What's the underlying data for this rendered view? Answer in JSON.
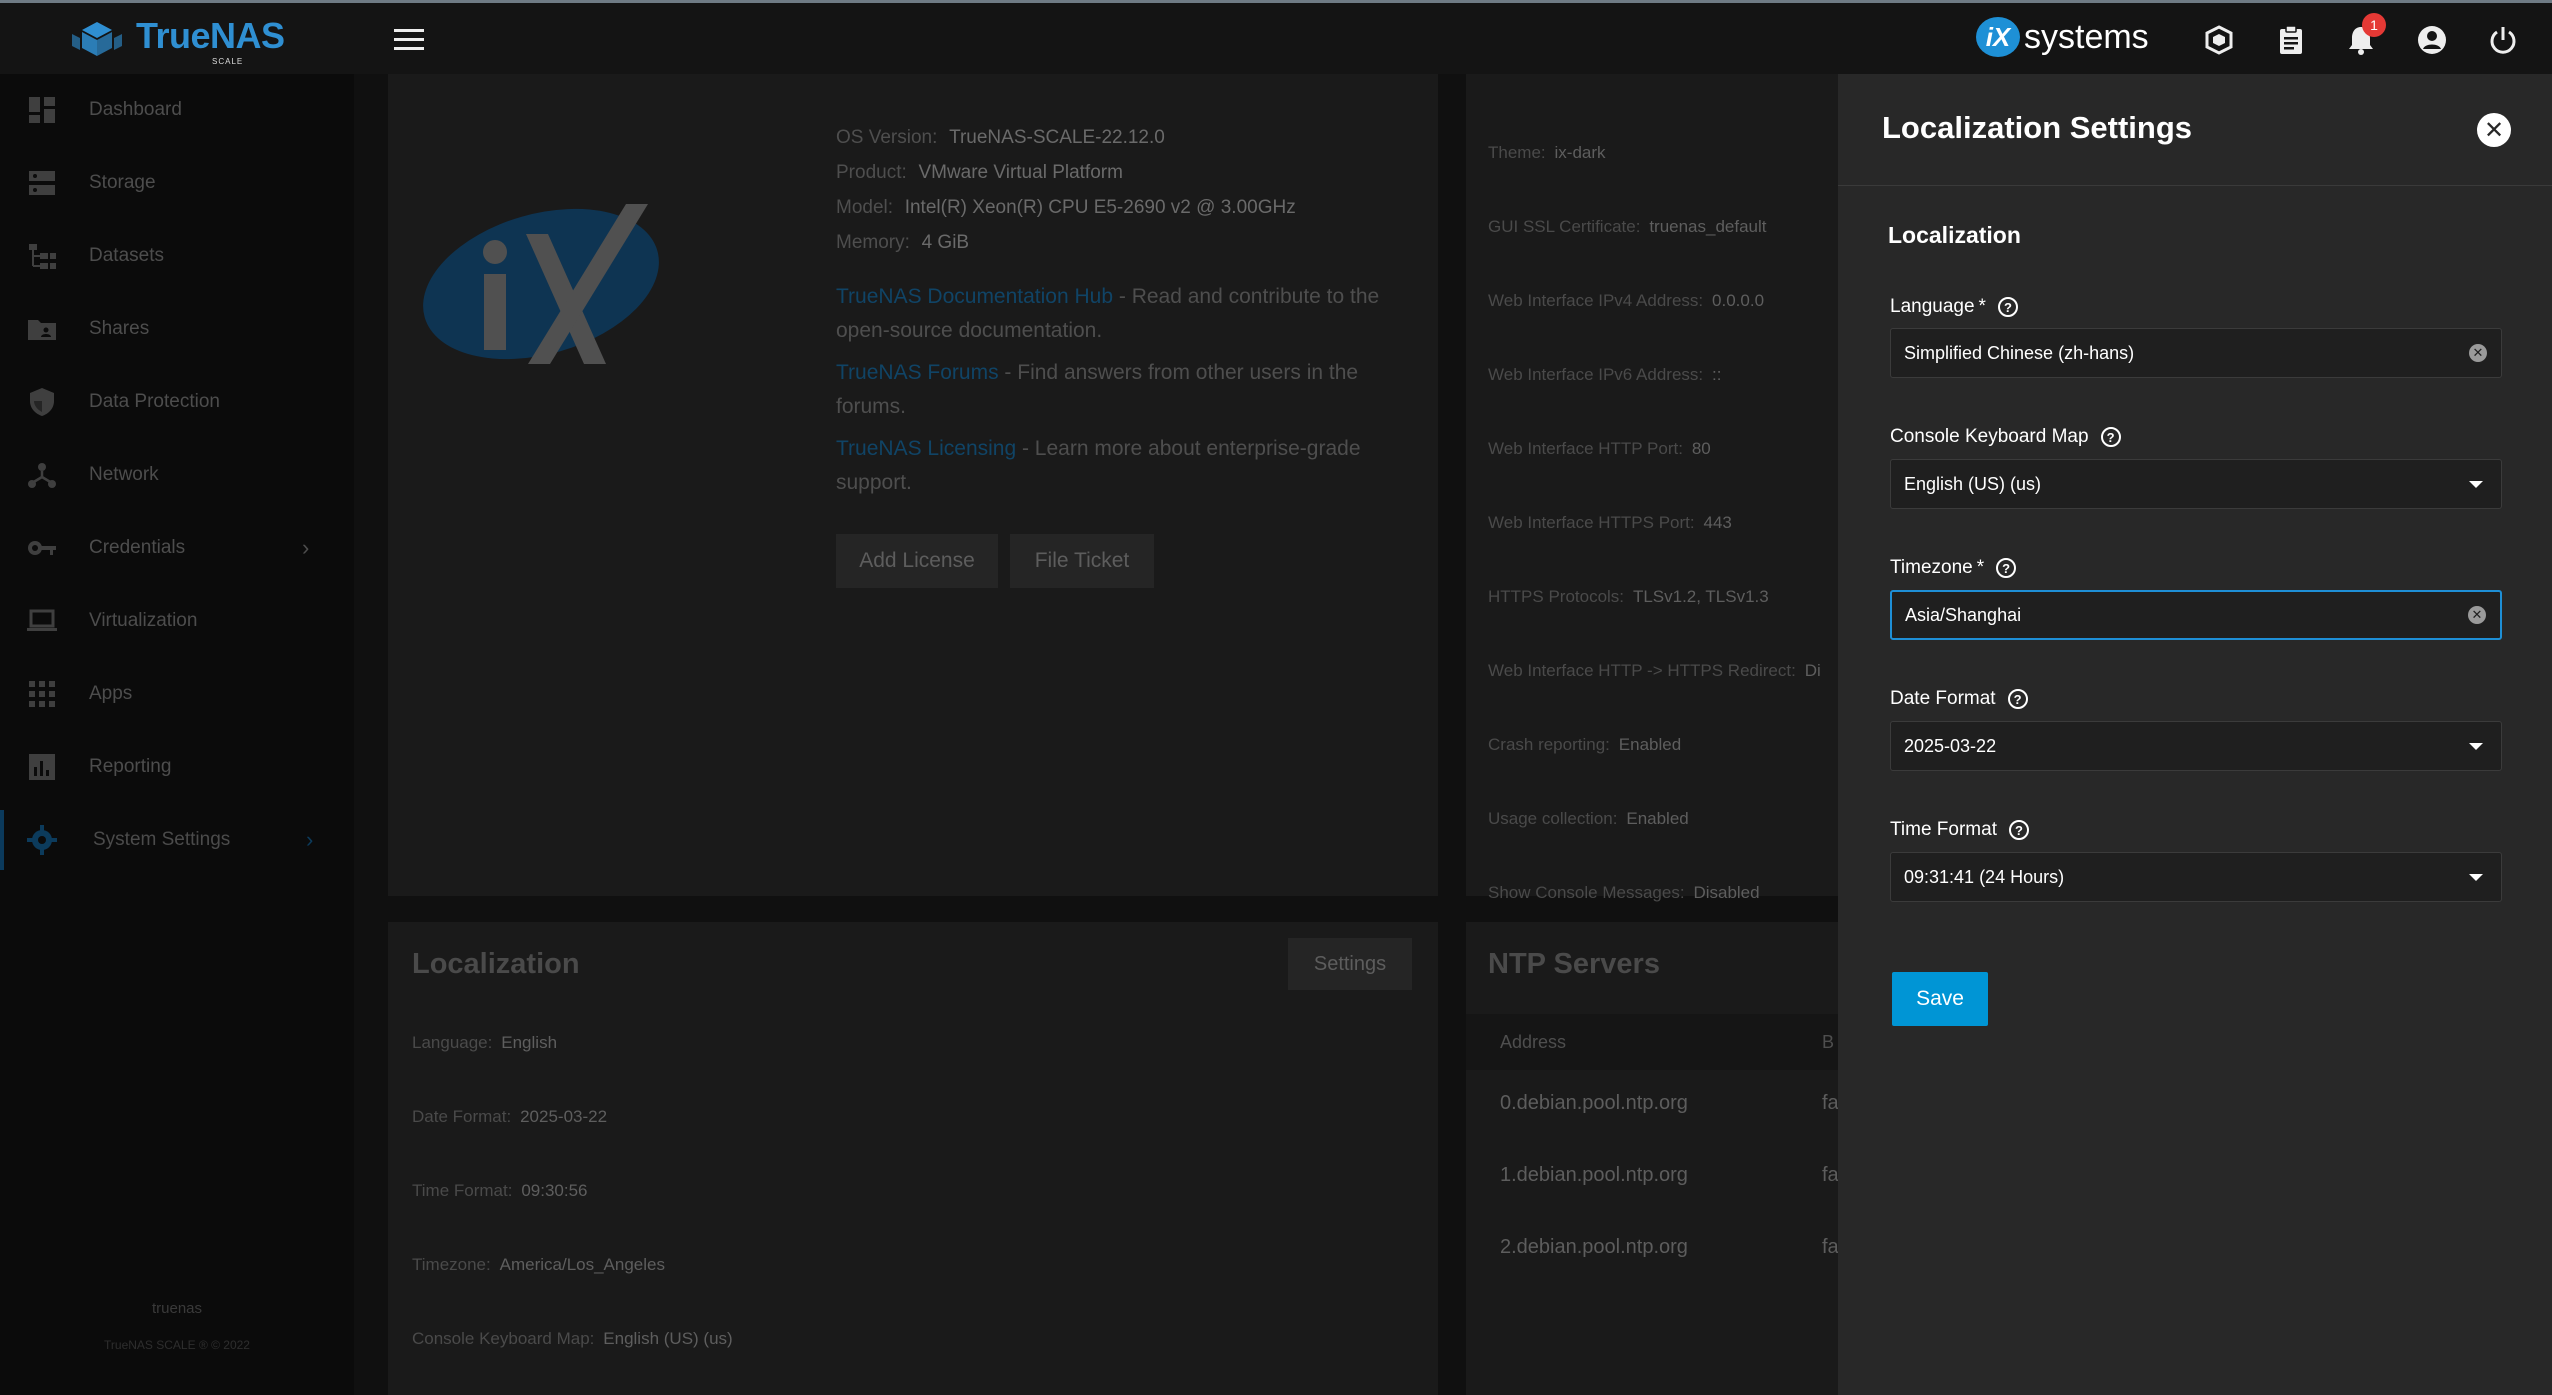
{
  "brand": {
    "logo_text": "TrueNAS",
    "logo_sub": "SCALE",
    "partner_ix": "iX",
    "partner_text": "systems"
  },
  "notifications": {
    "count": "1"
  },
  "sidebar": {
    "items": [
      {
        "label": "Dashboard",
        "icon": "dashboard-icon"
      },
      {
        "label": "Storage",
        "icon": "storage-icon"
      },
      {
        "label": "Datasets",
        "icon": "datasets-icon"
      },
      {
        "label": "Shares",
        "icon": "shares-folder-icon"
      },
      {
        "label": "Data Protection",
        "icon": "shield-icon"
      },
      {
        "label": "Network",
        "icon": "network-icon"
      },
      {
        "label": "Credentials",
        "icon": "key-icon"
      },
      {
        "label": "Virtualization",
        "icon": "laptop-icon"
      },
      {
        "label": "Apps",
        "icon": "apps-grid-icon"
      },
      {
        "label": "Reporting",
        "icon": "reporting-chart-icon"
      },
      {
        "label": "System Settings",
        "icon": "gear-icon"
      }
    ],
    "hostname": "truenas",
    "copyright": "TrueNAS SCALE ® © 2022"
  },
  "system_info": {
    "os_label": "OS Version:",
    "os_value": "TrueNAS-SCALE-22.12.0",
    "product_label": "Product:",
    "product_value": "VMware Virtual Platform",
    "model_label": "Model:",
    "model_value": "Intel(R) Xeon(R) CPU E5-2690 v2 @ 3.00GHz",
    "memory_label": "Memory:",
    "memory_value": "4 GiB",
    "doc_link": "TrueNAS Documentation Hub",
    "doc_text1": " - Read and contribute to the",
    "doc_text2": "open-source documentation.",
    "forums_link": "TrueNAS Forums",
    "forums_text1": " - Find answers from other users in the",
    "forums_text2": "forums.",
    "licensing_link": "TrueNAS Licensing",
    "licensing_text1": " - Learn more about enterprise-grade",
    "licensing_text2": "support.",
    "add_license": "Add License",
    "file_ticket": "File Ticket"
  },
  "gui": {
    "rows": [
      {
        "label": "Theme:",
        "value": "ix-dark"
      },
      {
        "label": "GUI SSL Certificate:",
        "value": "truenas_default"
      },
      {
        "label": "Web Interface IPv4 Address:",
        "value": "0.0.0.0"
      },
      {
        "label": "Web Interface IPv6 Address:",
        "value": "::"
      },
      {
        "label": "Web Interface HTTP Port:",
        "value": "80"
      },
      {
        "label": "Web Interface HTTPS Port:",
        "value": "443"
      },
      {
        "label": "HTTPS Protocols:",
        "value": "TLSv1.2, TLSv1.3"
      },
      {
        "label": "Web Interface HTTP -> HTTPS Redirect:",
        "value": "Di"
      },
      {
        "label": "Crash reporting:",
        "value": "Enabled"
      },
      {
        "label": "Usage collection:",
        "value": "Enabled"
      },
      {
        "label": "Show Console Messages:",
        "value": "Disabled"
      }
    ]
  },
  "localization_card": {
    "title": "Localization",
    "settings_button": "Settings",
    "rows": [
      {
        "label": "Language:",
        "value": "English"
      },
      {
        "label": "Date Format:",
        "value": "2025-03-22"
      },
      {
        "label": "Time Format:",
        "value": "09:30:56"
      },
      {
        "label": "Timezone:",
        "value": "America/Los_Angeles"
      },
      {
        "label": "Console Keyboard Map:",
        "value": "English (US) (us)"
      }
    ]
  },
  "ntp_card": {
    "title": "NTP Servers",
    "col_address": "Address",
    "col_second": "B",
    "rows": [
      {
        "address": "0.debian.pool.ntp.org",
        "second": "fa"
      },
      {
        "address": "1.debian.pool.ntp.org",
        "second": "fa"
      },
      {
        "address": "2.debian.pool.ntp.org",
        "second": "fa"
      }
    ]
  },
  "panel": {
    "title": "Localization Settings",
    "section": "Localization",
    "language_label": "Language",
    "language_value": "Simplified Chinese (zh-hans)",
    "keyboard_label": "Console Keyboard Map",
    "keyboard_value": "English (US) (us)",
    "timezone_label": "Timezone",
    "timezone_value": "Asia/Shanghai",
    "date_label": "Date Format",
    "date_value": "2025-03-22",
    "time_label": "Time Format",
    "time_value": "09:31:41 (24 Hours)",
    "required_mark": "*",
    "save": "Save"
  }
}
